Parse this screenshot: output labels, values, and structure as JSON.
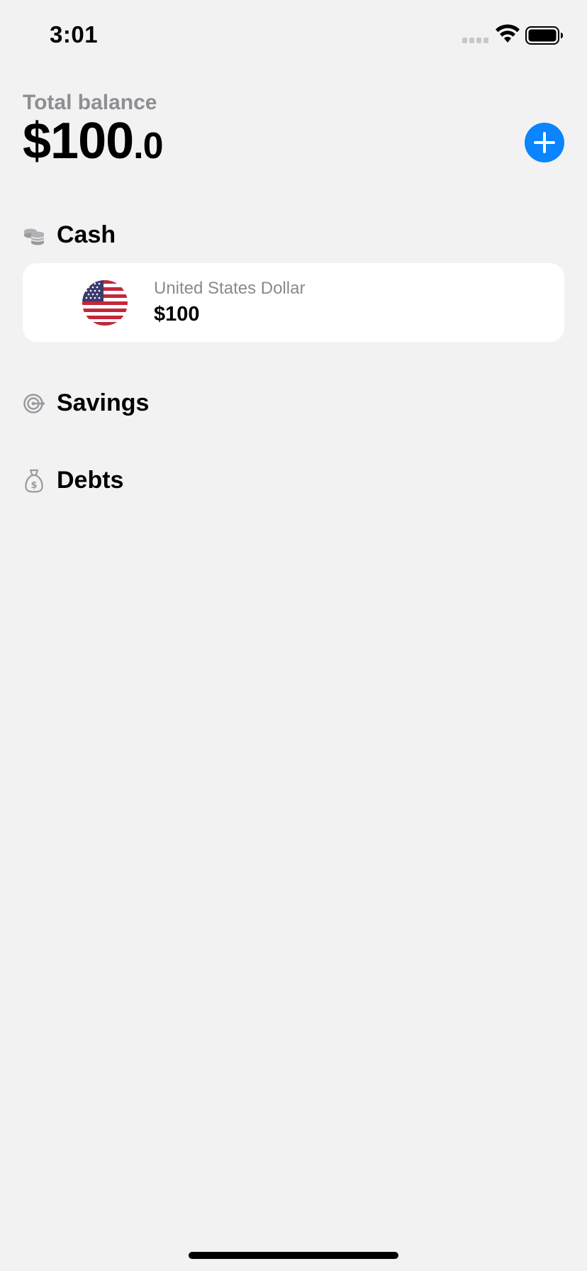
{
  "status_bar": {
    "time": "3:01"
  },
  "header": {
    "balance_label": "Total balance",
    "balance_main": "$100",
    "balance_cents": ".0",
    "add_icon": "plus-icon"
  },
  "sections": {
    "cash": {
      "title": "Cash",
      "icon": "coins-icon",
      "accounts": [
        {
          "currency_name": "United States Dollar",
          "balance": "$100",
          "flag": "us-flag-icon"
        }
      ]
    },
    "savings": {
      "title": "Savings",
      "icon": "target-icon"
    },
    "debts": {
      "title": "Debts",
      "icon": "money-bag-icon"
    }
  },
  "colors": {
    "background": "#f2f2f2",
    "accent": "#0a84ff",
    "secondary_text": "#8e8e93",
    "card": "#ffffff"
  }
}
